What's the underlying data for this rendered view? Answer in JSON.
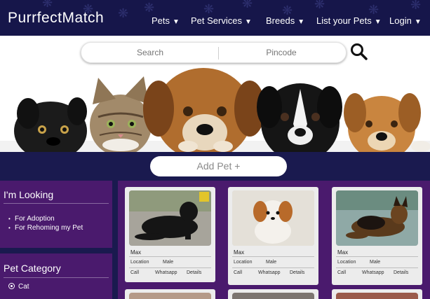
{
  "brand": "PurrfectMatch",
  "nav": [
    {
      "label": "Pets",
      "caret": "▼"
    },
    {
      "label": "Pet Services",
      "caret": "▼"
    },
    {
      "label": "Breeds",
      "caret": "▼"
    },
    {
      "label": "List your Pets",
      "caret": "▼"
    },
    {
      "label": "Login",
      "caret": "▼"
    }
  ],
  "search": {
    "placeholder": "Search",
    "pincode_placeholder": "Pincode",
    "icon": "search-icon"
  },
  "add_pet_label": "Add Pet +",
  "sidebar": {
    "looking_title": "I'm Looking",
    "looking_items": [
      "For Adoption",
      "For Rehoming my Pet"
    ],
    "category_title": "Pet Category",
    "category_option": "Cat"
  },
  "cards": [
    {
      "name": "Max",
      "location": "Location",
      "sex": "Male",
      "call": "Call",
      "whatsapp": "Whatsapp",
      "details": "Details"
    },
    {
      "name": "Max",
      "location": "Location",
      "sex": "Male",
      "call": "Call",
      "whatsapp": "Whatsapp",
      "details": "Details"
    },
    {
      "name": "Max",
      "location": "Location",
      "sex": "Male",
      "call": "Call",
      "whatsapp": "Whatsapp",
      "details": "Details"
    }
  ],
  "colors": {
    "navbar": "#16164a",
    "sidebar": "#4a1a6d",
    "band": "#1a1a4f"
  }
}
